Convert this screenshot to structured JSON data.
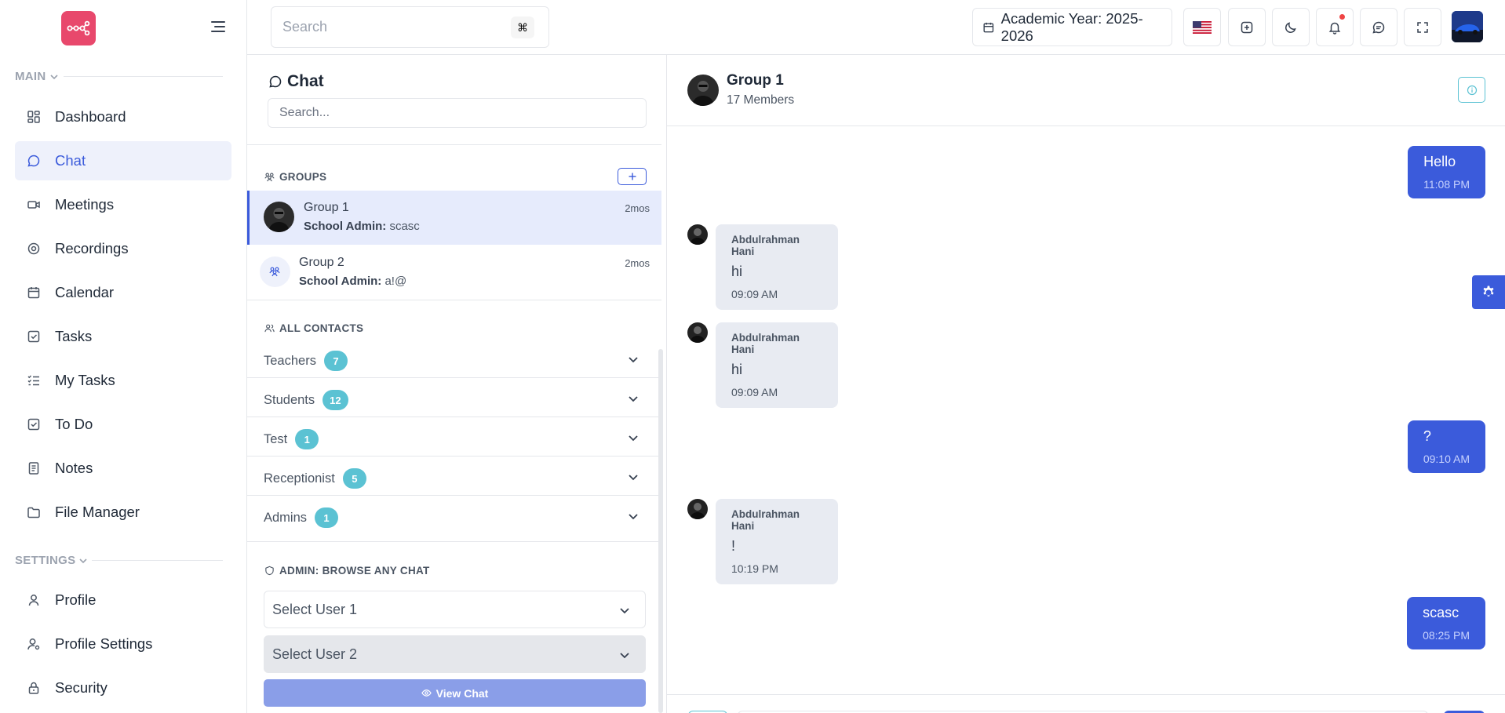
{
  "sidebar": {
    "sections": {
      "main": "MAIN",
      "settings": "SETTINGS"
    },
    "main_items": [
      {
        "label": "Dashboard",
        "icon": "dashboard-icon",
        "active": false
      },
      {
        "label": "Chat",
        "icon": "chat-icon",
        "active": true
      },
      {
        "label": "Meetings",
        "icon": "video-icon",
        "active": false
      },
      {
        "label": "Recordings",
        "icon": "recording-icon",
        "active": false
      },
      {
        "label": "Calendar",
        "icon": "calendar-icon",
        "active": false
      },
      {
        "label": "Tasks",
        "icon": "checkbox-icon",
        "active": false
      },
      {
        "label": "My Tasks",
        "icon": "list-check-icon",
        "active": false
      },
      {
        "label": "To Do",
        "icon": "checkbox-icon",
        "active": false
      },
      {
        "label": "Notes",
        "icon": "notes-icon",
        "active": false
      },
      {
        "label": "File Manager",
        "icon": "folder-icon",
        "active": false
      }
    ],
    "settings_items": [
      {
        "label": "Profile",
        "icon": "user-icon"
      },
      {
        "label": "Profile Settings",
        "icon": "user-cog-icon"
      },
      {
        "label": "Security",
        "icon": "lock-icon"
      }
    ]
  },
  "topbar": {
    "search_placeholder": "Search",
    "shortcut": "⌘",
    "academic_year": "Academic Year: 2025-2026",
    "flag": "us-flag-icon"
  },
  "chat_list": {
    "title": "Chat",
    "search_placeholder": "Search...",
    "groups_heading": "GROUPS",
    "groups": [
      {
        "name": "Group 1",
        "last_sender": "School Admin:",
        "last_message": "scasc",
        "time": "2mos",
        "active": true
      },
      {
        "name": "Group 2",
        "last_sender": "School Admin:",
        "last_message": "a!@",
        "time": "2mos",
        "active": false
      }
    ],
    "contacts_heading": "ALL CONTACTS",
    "contacts": [
      {
        "name": "Teachers",
        "count": "7"
      },
      {
        "name": "Students",
        "count": "12"
      },
      {
        "name": "Test",
        "count": "1"
      },
      {
        "name": "Receptionist",
        "count": "5"
      },
      {
        "name": "Admins",
        "count": "1"
      }
    ],
    "admin_heading": "ADMIN: BROWSE ANY CHAT",
    "select_user_1": "Select User 1",
    "select_user_2": "Select User 2",
    "view_chat": "View Chat"
  },
  "conversation": {
    "name": "Group 1",
    "members": "17 Members",
    "messages": [
      {
        "direction": "out",
        "text": "Hello",
        "time": "11:08 PM"
      },
      {
        "direction": "in",
        "sender": "Abdulrahman Hani",
        "text": "hi",
        "time": "09:09 AM"
      },
      {
        "direction": "in",
        "sender": "Abdulrahman Hani",
        "text": "hi",
        "time": "09:09 AM"
      },
      {
        "direction": "out",
        "text": "?",
        "time": "09:10 AM"
      },
      {
        "direction": "in",
        "sender": "Abdulrahman Hani",
        "text": "!",
        "time": "10:19 PM"
      },
      {
        "direction": "out",
        "text": "scasc",
        "time": "08:25 PM"
      }
    ]
  },
  "colors": {
    "primary": "#3b5bdb",
    "logo": "#e8486c",
    "badge": "#5bc2d3",
    "active_bg": "#eef1fb",
    "incoming_bubble": "#e8ebf2"
  }
}
